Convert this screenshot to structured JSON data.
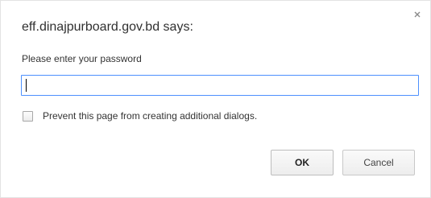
{
  "dialog": {
    "title": "eff.dinajpurboard.gov.bd says:",
    "message": "Please enter your password",
    "input_value": "",
    "checkbox_label": "Prevent this page from creating additional dialogs.",
    "checkbox_checked": false,
    "ok_label": "OK",
    "cancel_label": "Cancel",
    "close_icon": "close-icon"
  },
  "colors": {
    "input_focus_border": "#4d90fe",
    "text": "#333333"
  }
}
